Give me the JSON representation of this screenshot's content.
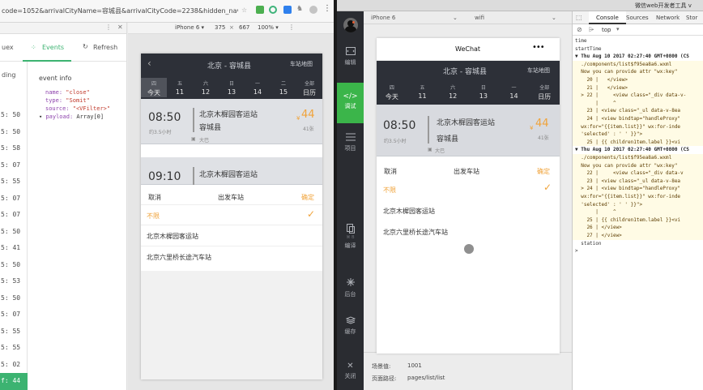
{
  "left": {
    "url": "code=1052&arrivalCityName=容城县&arrivalCityCode=2238&hidden_nav...",
    "tabs": {
      "vuex": "uex",
      "events": "Events",
      "refresh": "Refresh"
    },
    "row_label": "ding",
    "rows": [
      "5: 50",
      "5: 50",
      "5: 58",
      "5: 07",
      "5: 55",
      "5: 07",
      "5: 07",
      "5: 50",
      "5: 41",
      "5: 50",
      "5: 53",
      "5: 50",
      "5: 07",
      "5: 55",
      "5: 55",
      "5: 02",
      "f: 44"
    ],
    "event_info": {
      "title": "event info",
      "name_key": "name:",
      "name_val": "\"close\"",
      "type_key": "type:",
      "type_val": "\"Somit\"",
      "source_key": "source:",
      "source_val": "\"<VFilter>\"",
      "payload_key": "payload:",
      "payload_val": "Array[0]"
    },
    "device": {
      "model": "iPhone 6 ▾",
      "width": "375",
      "x": "×",
      "height": "667",
      "zoom": "100% ▾"
    },
    "phone": {
      "route": "北京 - 容城县",
      "map_link": "车站地图",
      "dates": [
        {
          "w": "四",
          "d": "今天"
        },
        {
          "w": "五",
          "d": "11"
        },
        {
          "w": "六",
          "d": "12"
        },
        {
          "w": "日",
          "d": "13"
        },
        {
          "w": "一",
          "d": "14"
        },
        {
          "w": "二",
          "d": "15"
        },
        {
          "w": "全部",
          "d": "日历"
        }
      ],
      "trip1": {
        "time": "08:50",
        "dur": "约3.5小时",
        "from": "北京木樨园客运站",
        "to": "容城县",
        "bus": "大巴",
        "price": "44",
        "yen": "¥",
        "seats": "41张"
      },
      "trip2": {
        "time": "09:10",
        "from": "北京木樨园客运站"
      },
      "sheet": {
        "cancel": "取消",
        "title": "出发车站",
        "ok": "确定",
        "opt0": "不限",
        "opt1": "北京木樨园客运站",
        "opt2": "北京六里桥长途汽车站"
      }
    }
  },
  "right": {
    "window_title": "微信web开发者工具 v",
    "toolbar": {
      "device": "iPhone 6",
      "network": "wifi"
    },
    "sidebar": {
      "edit": "编辑",
      "debug": "调试",
      "project": "项目",
      "compile": "编译",
      "background": "后台",
      "cache": "缓存",
      "close": "关闭"
    },
    "phone": {
      "nav_title": "WeChat",
      "dots": "•••",
      "route": "北京 - 容城县",
      "map_link": "车站地图",
      "dates": [
        {
          "w": "四",
          "d": "今天"
        },
        {
          "w": "五",
          "d": "11"
        },
        {
          "w": "六",
          "d": "12"
        },
        {
          "w": "日",
          "d": "13"
        },
        {
          "w": "一",
          "d": "14"
        },
        {
          "w": "全部",
          "d": "日历"
        }
      ],
      "trip1": {
        "time": "08:50",
        "dur": "约3.5小时",
        "from": "北京木樨园客运站",
        "to": "容城县",
        "bus": "大巴",
        "yen": "¥",
        "price": "44",
        "seats": "41张"
      },
      "sheet": {
        "cancel": "取消",
        "title": "出发车站",
        "ok": "确定",
        "opt0": "不限",
        "opt1": "北京木樨园客运站",
        "opt2": "北京六里桥长途汽车站"
      }
    },
    "scene_label": "场景值:",
    "scene_value": "1001",
    "path_label": "页面路径:",
    "path_value": "pages/list/list",
    "devtools": {
      "tabs": {
        "console": "Console",
        "sources": "Sources",
        "network": "Network",
        "storage": "Stor"
      },
      "filter": "top",
      "lines": [
        "time",
        "startTime",
        "▼ Thu Aug 10 2017 02:27:40 GMT+0800 (CS",
        "  ./components/list$f95ea8a6.wxml",
        "  Now you can provide attr \"wx:key\"",
        "    20 |   </view>",
        "    21 |   </view>",
        "  > 22 |     <view class=\"_div data-v-",
        "       |     ^",
        "    23 | <view class=\"_ul data-v-8ea",
        "    24 | <view bindtap=\"handleProxy\"",
        "  wx:for=\"{{item.list}}\" wx:for-inde",
        "  'selected' : ' ' }}\">",
        "    25 | {{ children1tem.label }}<vi",
        "▼ Thu Aug 10 2017 02:27:40 GMT+0800 (CS",
        "  ./components/list$f95ea8a6.wxml",
        "  Now you can provide attr \"wx:key\"",
        "    22 |     <view class=\"_div data-v",
        "    23 | <view class=\"_ul data-v-8ea",
        "  > 24 | <view bindtap=\"handleProxy\"",
        "  wx:for=\"{{item.list}}\" wx:for-inde",
        "  'selected' : ' ' }}\">",
        "       |     ^",
        "    25 | {{ children1tem.label }}<vi",
        "    26 | </view>",
        "    27 | </view>",
        "  station",
        ">"
      ]
    }
  },
  "colors": {
    "green": "#3cb371",
    "orange": "#f0a33a",
    "dark": "#2d3038",
    "wechat_green": "#3bb54a",
    "warn": "#fffbe5"
  }
}
